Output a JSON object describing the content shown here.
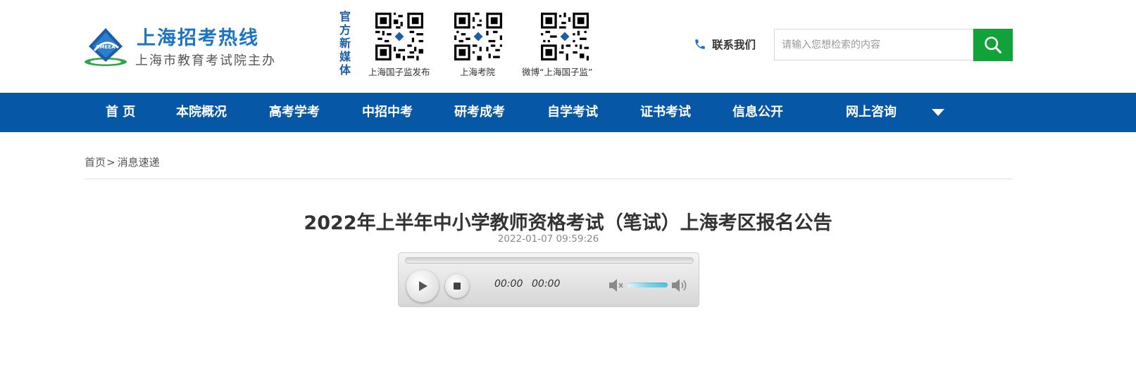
{
  "header": {
    "logo_title": "上海招考热线",
    "logo_subtitle": "上海市教育考试院主办",
    "logo_emblem_text": "SMEEA",
    "media_label": "官方新媒体",
    "qr_codes": [
      {
        "caption": "上海国子监发布"
      },
      {
        "caption": "上海考院"
      },
      {
        "caption": "微博“上海国子监”"
      }
    ],
    "contact_label": "联系我们",
    "search_placeholder": "请输入您想检索的内容",
    "search_value": ""
  },
  "nav": {
    "items": [
      "首 页",
      "本院概况",
      "高考学考",
      "中招中考",
      "研考成考",
      "自学考试",
      "证书考试",
      "信息公开",
      "网上咨询"
    ]
  },
  "breadcrumb": {
    "home": "首页",
    "separator": ">",
    "current": "消息速递"
  },
  "article": {
    "title": "2022年上半年中小学教师资格考试（笔试）上海考区报名公告",
    "date": "2022-01-07 09:59:26"
  },
  "player": {
    "current_time": "00:00",
    "duration": "00:00",
    "progress": 0,
    "volume": 1.0
  },
  "colors": {
    "brand_blue": "#0658a6",
    "logo_blue": "#1a73c6",
    "search_green": "#12a23a"
  }
}
